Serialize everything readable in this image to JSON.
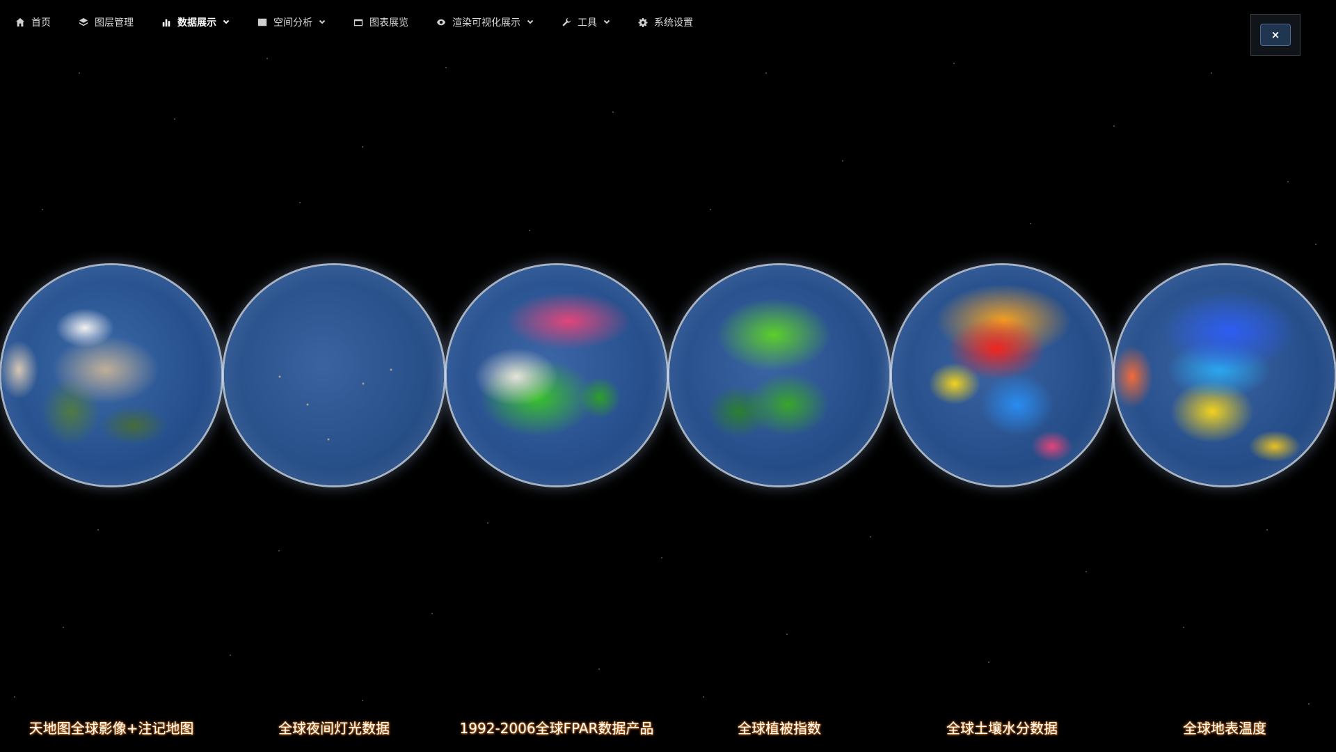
{
  "nav": {
    "items": [
      {
        "label": "首页",
        "icon": "home-icon",
        "dropdown": false,
        "active": false
      },
      {
        "label": "图层管理",
        "icon": "layers-icon",
        "dropdown": false,
        "active": false
      },
      {
        "label": "数据展示",
        "icon": "bar-chart-icon",
        "dropdown": true,
        "active": true
      },
      {
        "label": "空间分析",
        "icon": "map-analysis-icon",
        "dropdown": true,
        "active": false
      },
      {
        "label": "图表展览",
        "icon": "window-icon",
        "dropdown": false,
        "active": false
      },
      {
        "label": "渲染可视化展示",
        "icon": "eye-icon",
        "dropdown": true,
        "active": false
      },
      {
        "label": "工具",
        "icon": "wrench-icon",
        "dropdown": true,
        "active": false
      },
      {
        "label": "系统设置",
        "icon": "gear-icon",
        "dropdown": false,
        "active": false
      }
    ]
  },
  "close": {
    "label": "×"
  },
  "globes": [
    {
      "label": "天地图全球影像+注记地图"
    },
    {
      "label": "全球夜间灯光数据"
    },
    {
      "label": "1992-2006全球FPAR数据产品"
    },
    {
      "label": "全球植被指数"
    },
    {
      "label": "全球土壤水分数据"
    },
    {
      "label": "全球地表温度"
    }
  ],
  "colors": {
    "background": "#000000",
    "label_glow": "#e58a2b",
    "close_button": "#1f3550"
  }
}
